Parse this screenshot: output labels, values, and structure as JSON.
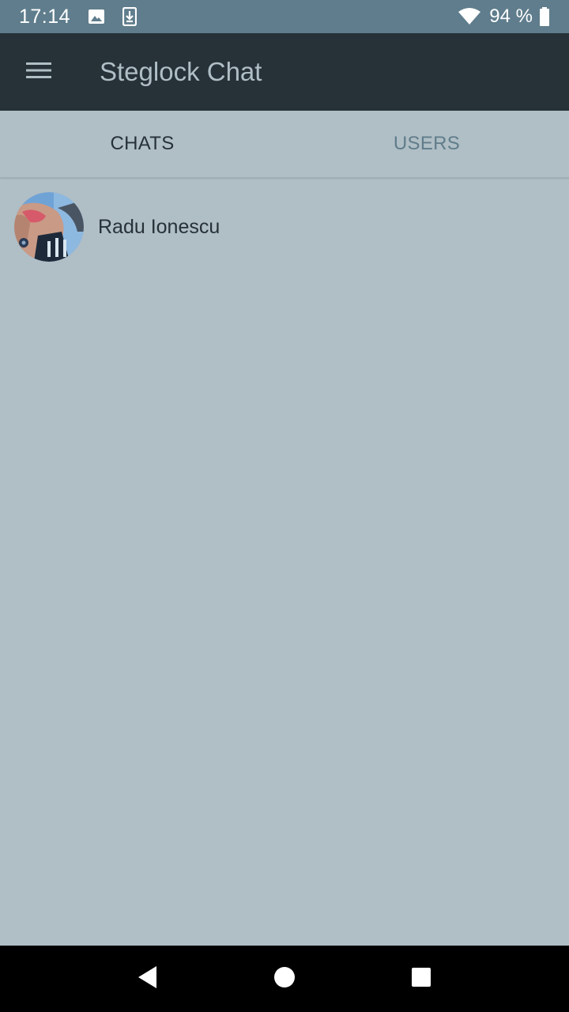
{
  "status_bar": {
    "time": "17:14",
    "battery_percent": "94 %",
    "icons": [
      "image-icon",
      "download-icon",
      "wifi-icon",
      "battery-icon"
    ]
  },
  "app_bar": {
    "title": "Steglock Chat",
    "menu_icon": "menu-icon"
  },
  "tabs": [
    {
      "label": "CHATS",
      "active": true
    },
    {
      "label": "USERS",
      "active": false
    }
  ],
  "chats": [
    {
      "name": "Radu Ionescu",
      "avatar": "user-photo"
    }
  ],
  "nav_bar": {
    "icons": [
      "back-icon",
      "home-icon",
      "recents-icon"
    ]
  },
  "colors": {
    "status_bar": "#5f7d8c",
    "app_bar": "#263238",
    "background": "#b0bec5",
    "active_tab": "#263238",
    "inactive_tab": "#607d8b"
  }
}
